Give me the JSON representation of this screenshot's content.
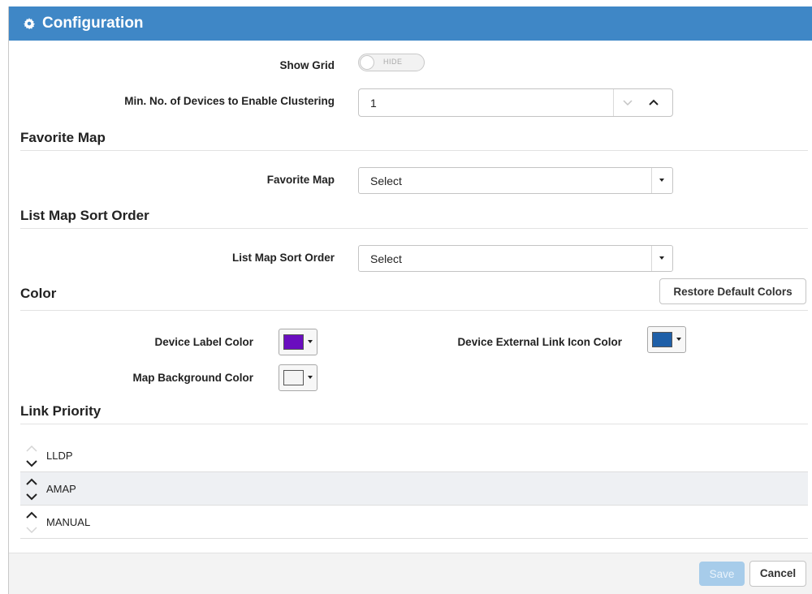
{
  "window": {
    "title": "Configuration"
  },
  "general": {
    "show_grid_label": "Show Grid",
    "show_grid_toggle_text": "HIDE",
    "clustering_label": "Min. No. of Devices to Enable Clustering",
    "clustering_value": "1"
  },
  "favorite_map": {
    "section_title": "Favorite Map",
    "field_label": "Favorite Map",
    "selected": "Select"
  },
  "sort_order": {
    "section_title": "List Map Sort Order",
    "field_label": "List Map Sort Order",
    "selected": "Select"
  },
  "color": {
    "section_title": "Color",
    "restore_button": "Restore Default Colors",
    "device_label_color_label": "Device Label Color",
    "device_label_color": "#6a0dbf",
    "external_link_icon_color_label": "Device External Link Icon Color",
    "external_link_icon_color": "#1e5fa8",
    "map_background_color_label": "Map Background Color",
    "map_background_color": "#f4f4f4"
  },
  "link_priority": {
    "section_title": "Link Priority",
    "items": [
      {
        "label": "LLDP"
      },
      {
        "label": "AMAP"
      },
      {
        "label": "MANUAL"
      }
    ]
  },
  "footer": {
    "save_label": "Save",
    "cancel_label": "Cancel"
  },
  "colors": {
    "header_bg": "#3f87c6",
    "save_disabled_bg": "#a7ccea"
  }
}
